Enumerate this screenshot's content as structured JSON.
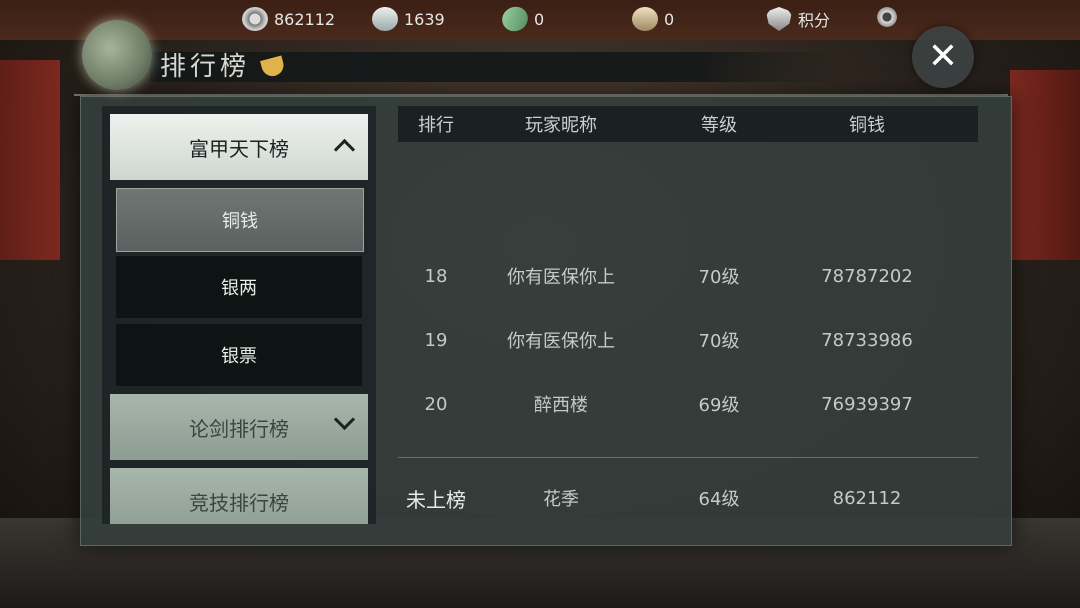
{
  "currencies": [
    {
      "icon": "film-reel-icon",
      "value": "862112"
    },
    {
      "icon": "silver-ingot-icon",
      "value": "1639"
    },
    {
      "icon": "banknote-plus-icon",
      "value": "0"
    },
    {
      "icon": "gold-ingot-plus-icon",
      "value": "0"
    },
    {
      "icon": "shield-points-icon",
      "value": "积分"
    }
  ],
  "title": "排行榜",
  "close_label": "✕",
  "menu": {
    "open_category": "富甲天下榜",
    "sub_items": [
      "铜钱",
      "银两",
      "银票"
    ],
    "active_sub": 0,
    "closed_categories": [
      "论剑排行榜",
      "竞技排行榜"
    ]
  },
  "table": {
    "headers": {
      "rank": "排行",
      "name": "玩家昵称",
      "level": "等级",
      "coin": "铜钱"
    },
    "rows": [
      {
        "rank": "18",
        "name": "你有医保你上",
        "level": "70级",
        "coin": "78787202"
      },
      {
        "rank": "19",
        "name": "你有医保你上",
        "level": "70级",
        "coin": "78733986"
      },
      {
        "rank": "20",
        "name": "醉西楼",
        "level": "69级",
        "coin": "76939397"
      }
    ],
    "mine": {
      "rank": "未上榜",
      "name": "花季",
      "level": "64级",
      "coin": "862112"
    }
  },
  "colors": {
    "accent": "#e0b24a",
    "panel": "#343e3c"
  }
}
